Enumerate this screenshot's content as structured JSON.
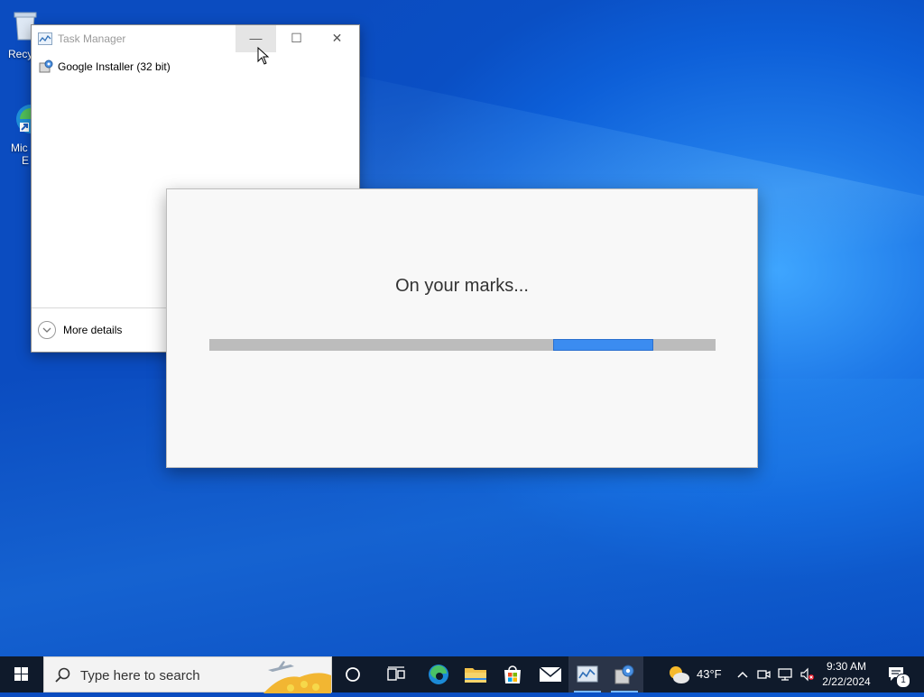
{
  "desktop": {
    "icons": [
      {
        "label": "Recy"
      },
      {
        "label": "Mic"
      },
      {
        "label": "E"
      }
    ]
  },
  "task_manager": {
    "title": "Task Manager",
    "minimize_glyph": "—",
    "maximize_glyph": "☐",
    "close_glyph": "✕",
    "processes": [
      {
        "name": "Google Installer (32 bit)",
        "icon": "installer-icon"
      }
    ],
    "more_details_label": "More details"
  },
  "installer": {
    "message": "On your marks...",
    "progress_state": "indeterminate",
    "accent_color": "#3b8cf0"
  },
  "taskbar": {
    "search_placeholder": "Type here to search",
    "pinned_apps": [
      "cortana-icon",
      "task-view-icon",
      "edge-icon",
      "file-explorer-icon",
      "store-icon",
      "mail-icon",
      "task-manager-icon",
      "installer-icon"
    ],
    "weather": {
      "temperature": "43°F",
      "icon": "partly-cloudy-icon"
    },
    "clock": {
      "time": "9:30 AM",
      "date": "2/22/2024"
    },
    "notification_count": "1"
  }
}
